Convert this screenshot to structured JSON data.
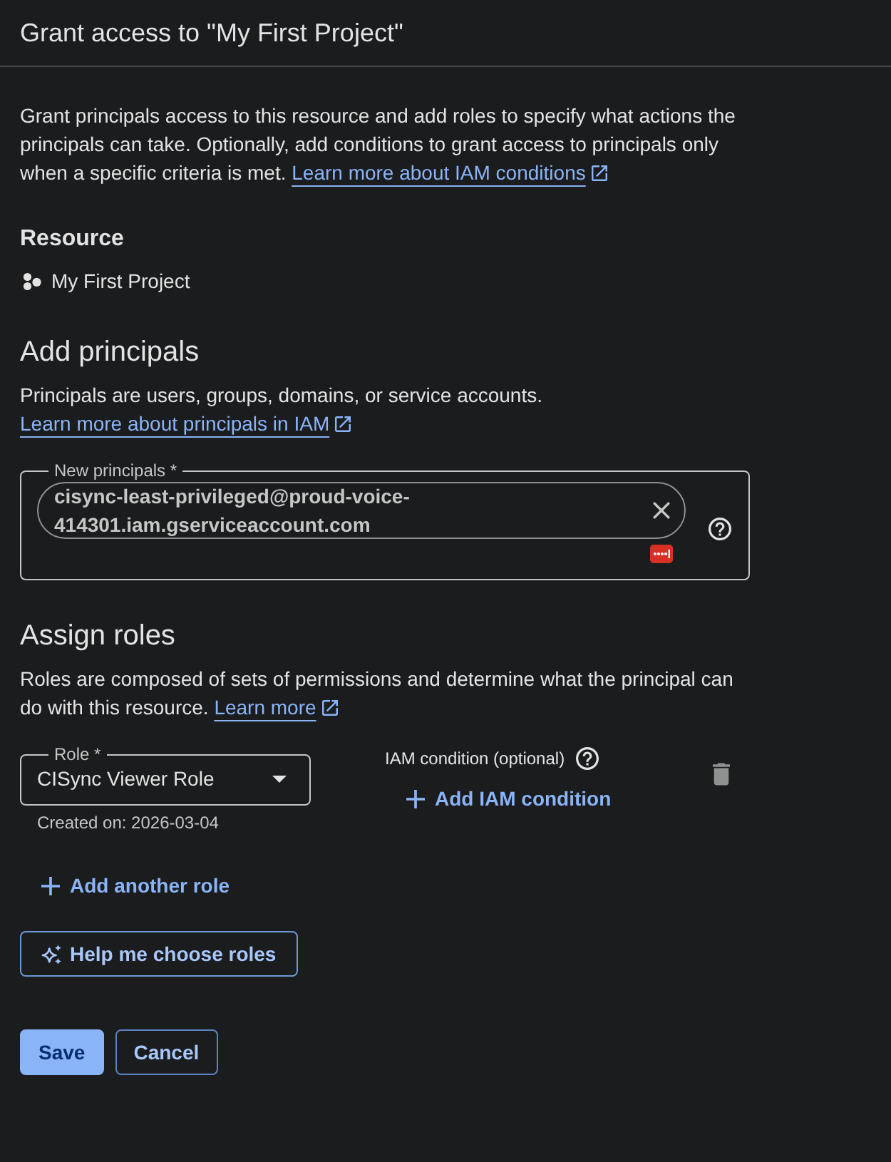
{
  "dialog": {
    "title": "Grant access to \"My First Project\""
  },
  "intro": {
    "text": "Grant principals access to this resource and add roles to specify what actions the principals can take. Optionally, add conditions to grant access to principals only when a specific criteria is met.",
    "link": "Learn more about IAM conditions"
  },
  "resource": {
    "heading": "Resource",
    "name": "My First Project"
  },
  "add_principals": {
    "heading": "Add principals",
    "description": "Principals are users, groups, domains, or service accounts.",
    "link": "Learn more about principals in IAM",
    "field": {
      "label": "New principals *",
      "chips": [
        {
          "text": "cisync-least-privileged@proud-voice-414301.iam.gserviceaccount.com"
        }
      ]
    }
  },
  "assign_roles": {
    "heading": "Assign roles",
    "description": "Roles are composed of sets of permissions and determine what the principal can do with this resource.",
    "link": "Learn more",
    "roles": [
      {
        "label": "Role *",
        "value": "CISync Viewer Role",
        "hint": "Created on: 2026-03-04",
        "condition_label": "IAM condition (optional)",
        "condition_action": "Add IAM condition"
      }
    ],
    "add_role": "Add another role",
    "help_button": "Help me choose roles"
  },
  "actions": [
    {
      "label": "Save",
      "kind": "primary"
    },
    {
      "label": "Cancel",
      "kind": "secondary"
    }
  ]
}
